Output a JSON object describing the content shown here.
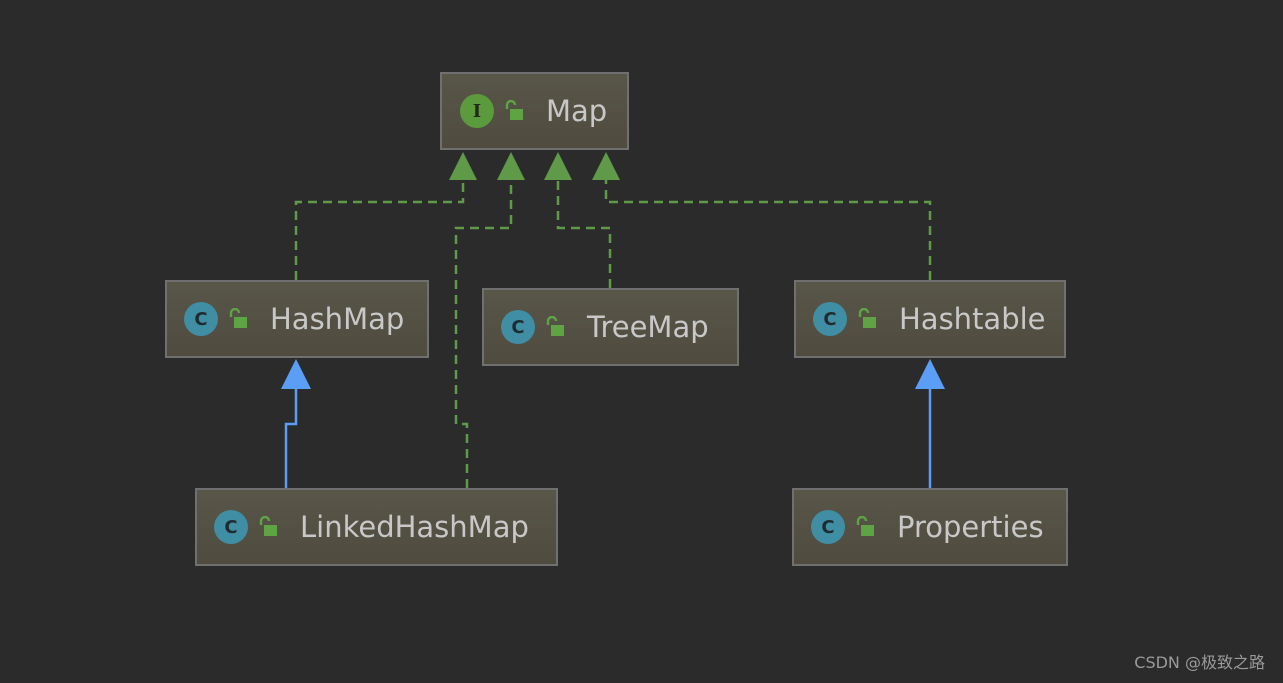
{
  "diagram": {
    "nodes": [
      {
        "id": "map",
        "name": "Map",
        "kind": "interface",
        "badge": "I"
      },
      {
        "id": "hashmap",
        "name": "HashMap",
        "kind": "class",
        "badge": "C"
      },
      {
        "id": "treemap",
        "name": "TreeMap",
        "kind": "class",
        "badge": "C"
      },
      {
        "id": "hashtable",
        "name": "Hashtable",
        "kind": "class",
        "badge": "C"
      },
      {
        "id": "linkedhashmap",
        "name": "LinkedHashMap",
        "kind": "class",
        "badge": "C"
      },
      {
        "id": "properties",
        "name": "Properties",
        "kind": "class",
        "badge": "C"
      }
    ],
    "edges": [
      {
        "from": "HashMap",
        "to": "Map",
        "relation": "implements"
      },
      {
        "from": "LinkedHashMap",
        "to": "Map",
        "relation": "implements"
      },
      {
        "from": "TreeMap",
        "to": "Map",
        "relation": "implements"
      },
      {
        "from": "Hashtable",
        "to": "Map",
        "relation": "implements"
      },
      {
        "from": "LinkedHashMap",
        "to": "HashMap",
        "relation": "extends"
      },
      {
        "from": "Properties",
        "to": "Hashtable",
        "relation": "extends"
      }
    ]
  },
  "colors": {
    "background": "#2b2b2b",
    "implements_edge": "#5e9a48",
    "extends_edge": "#5a9ef5",
    "class_badge": "#3f8ea3",
    "interface_badge": "#5b9b3e",
    "lock_icon": "#5ea344"
  },
  "icons": {
    "class_badge": "class-icon",
    "interface_badge": "interface-icon",
    "visibility": "public-lock-icon"
  },
  "watermark": "CSDN @极致之路"
}
